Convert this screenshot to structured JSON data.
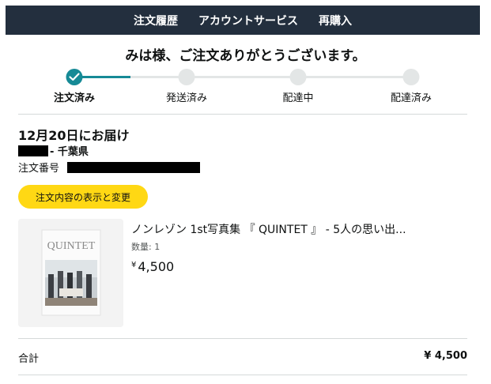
{
  "nav": {
    "items": [
      "注文履歴",
      "アカウントサービス",
      "再購入"
    ]
  },
  "greeting": "みは様、ご注文ありがとうございます。",
  "tracker": {
    "steps": [
      {
        "label": "注文済み",
        "done": true
      },
      {
        "label": "発送済み",
        "done": false
      },
      {
        "label": "配達中",
        "done": false
      },
      {
        "label": "配達済み",
        "done": false
      }
    ],
    "accent_color": "#168a96"
  },
  "delivery": {
    "date_text": "12月20日にお届け",
    "prefecture": "- 千葉県",
    "order_number_label": "注文番号"
  },
  "buttons": {
    "order_details": "注文内容の表示と変更"
  },
  "product": {
    "title": "ノンレゾン 1st写真集 『 QUINTET 』 - 5人の思い出...",
    "quantity": "数量: 1",
    "currency": "¥",
    "price": "4,500",
    "cover_text": "QUINTET"
  },
  "total": {
    "label": "合計",
    "value": "¥ 4,500"
  },
  "colors": {
    "nav_bg": "#232f3e",
    "button_bg": "#ffd814"
  }
}
